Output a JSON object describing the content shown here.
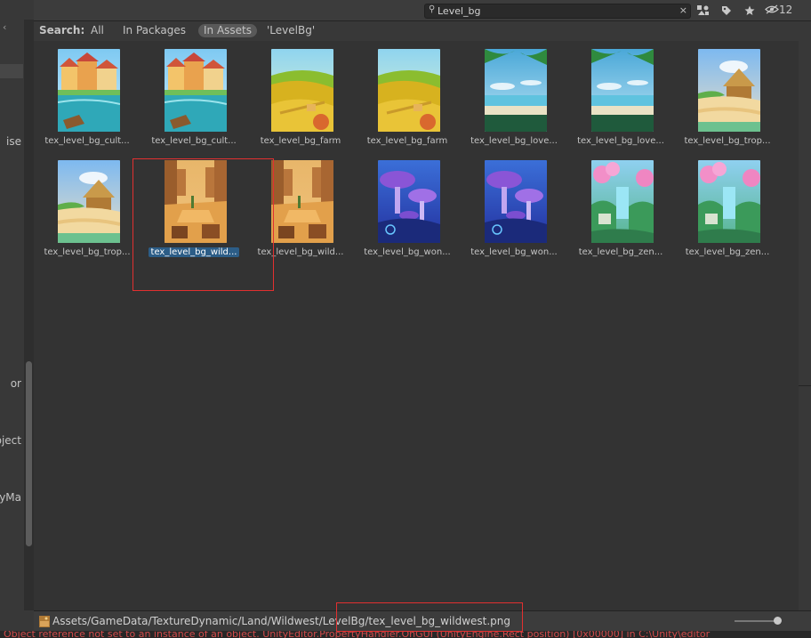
{
  "left_pane": {
    "labels": [
      "ise",
      "or",
      "oject",
      "cyMa"
    ]
  },
  "toolbar": {
    "search_value": "Level_bg",
    "clear_glyph": "×",
    "hidden_count": "12",
    "icons": [
      "create-by-type-icon",
      "label-tag-icon",
      "favorite-star-icon",
      "hidden-eye-icon"
    ]
  },
  "scope": {
    "label": "Search:",
    "all": "All",
    "packages": "In Packages",
    "assets": "In Assets",
    "folder": "'LevelBg'"
  },
  "assets": [
    {
      "name": "tex_level_bg_cult...",
      "theme": "culture"
    },
    {
      "name": "tex_level_bg_cult...",
      "theme": "culture"
    },
    {
      "name": "tex_level_bg_farm",
      "theme": "farm"
    },
    {
      "name": "tex_level_bg_farm",
      "theme": "farm"
    },
    {
      "name": "tex_level_bg_love...",
      "theme": "love"
    },
    {
      "name": "tex_level_bg_love...",
      "theme": "love"
    },
    {
      "name": "tex_level_bg_trop...",
      "theme": "tropical"
    },
    {
      "name": "tex_level_bg_trop...",
      "theme": "tropical"
    },
    {
      "name": "tex_level_bg_wild...",
      "theme": "wildwest",
      "selected": true
    },
    {
      "name": "tex_level_bg_wild...",
      "theme": "wildwest"
    },
    {
      "name": "tex_level_bg_won...",
      "theme": "wonder"
    },
    {
      "name": "tex_level_bg_won...",
      "theme": "wonder"
    },
    {
      "name": "tex_level_bg_zen...",
      "theme": "zen"
    },
    {
      "name": "tex_level_bg_zen...",
      "theme": "zen"
    }
  ],
  "path_bar": {
    "path": "Assets/GameData/TextureDynamic/Land/Wildwest/LevelBg/tex_level_bg_wildwest.png"
  },
  "console": {
    "message": "Object reference not set to an instance of an object. UnityEditor.PropertyHandler.OnGUI (UnityEngine.Rect position) [0x00000] in C:\\Unity\\editor"
  },
  "colors": {
    "selection": "#2c5d87",
    "annotation": "#e23030",
    "error_text": "#d14b4b"
  }
}
